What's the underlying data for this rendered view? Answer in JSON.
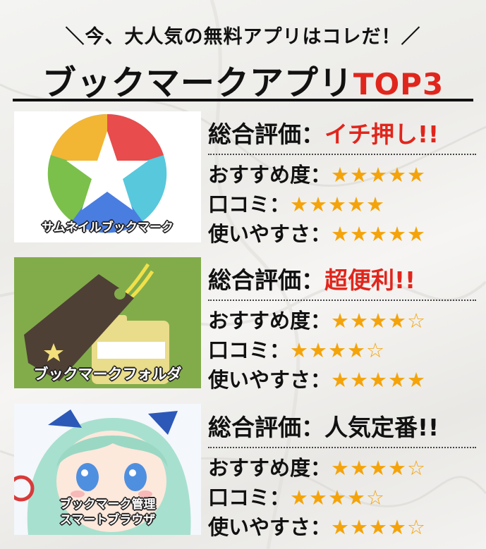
{
  "header": {
    "subtitle": "＼今、大人気の無料アプリはコレだ！／",
    "title_main": "ブックマークアプリ",
    "title_accent": "TOP3"
  },
  "apps": [
    {
      "name_lines": [
        "サムネイルブックマーク"
      ],
      "overall_label": "総合評価：",
      "overall_value": "イチ押し!!",
      "rows": [
        {
          "label": "おすすめ度：",
          "stars": "★★★★★"
        },
        {
          "label": "口コミ：",
          "stars": "★★★★★"
        },
        {
          "label": "使いやすさ：",
          "stars": "★★★★★"
        }
      ]
    },
    {
      "name_lines": [
        "ブックマークフォルダ"
      ],
      "overall_label": "総合評価：",
      "overall_value": "超便利!!",
      "rows": [
        {
          "label": "おすすめ度：",
          "stars": "★★★★☆"
        },
        {
          "label": "口コミ：",
          "stars": "★★★★☆"
        },
        {
          "label": "使いやすさ：",
          "stars": "★★★★★"
        }
      ]
    },
    {
      "name_lines": [
        "ブックマーク管理",
        "スマートブラウザ"
      ],
      "overall_label": "総合評価：",
      "overall_value": "人気定番!!",
      "rows": [
        {
          "label": "おすすめ度：",
          "stars": "★★★★☆"
        },
        {
          "label": "口コミ：",
          "stars": "★★★★☆"
        },
        {
          "label": "使いやすさ：",
          "stars": "★★★★☆"
        }
      ]
    }
  ],
  "colors": {
    "accent": "#e0261c",
    "star": "#f4a30a",
    "card2_bg": "#82ac4a"
  },
  "icons": [
    "star-wheel-icon",
    "bookmark-tag-icon",
    "anime-girl-icon"
  ]
}
